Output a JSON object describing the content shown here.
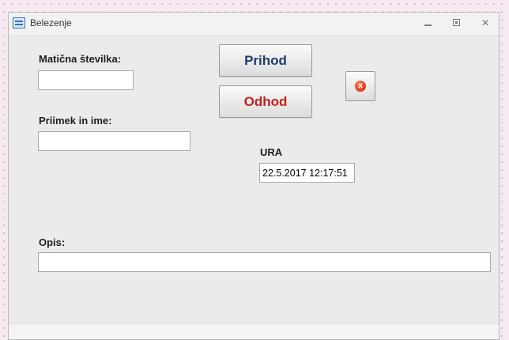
{
  "window": {
    "title": "Belezenje",
    "controls": {
      "minimize_icon": "minimize-icon",
      "maximize_icon": "maximize-icon",
      "close_icon": "close-icon",
      "close_glyph": "✕"
    }
  },
  "form": {
    "maticna_label": "Matična številka:",
    "maticna_value": "",
    "priimek_label": "Priimek in ime:",
    "priimek_value": "",
    "ura_label": "URA",
    "ura_value": "22.5.2017 12:17:51",
    "opis_label": "Opis:",
    "opis_value": ""
  },
  "buttons": {
    "prihod": "Prihod",
    "odhod": "Odhod",
    "exit_icon": "exit-icon",
    "exit_glyph": "x"
  },
  "colors": {
    "prihod_text": "#1f3c6a",
    "odhod_text": "#c0201a",
    "window_bg": "#ebebeb",
    "desktop_bg": "#f7e9f1"
  }
}
